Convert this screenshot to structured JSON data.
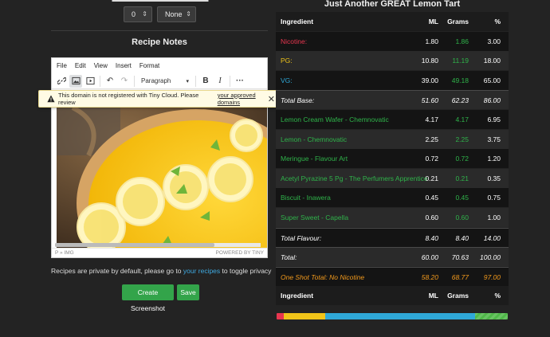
{
  "left": {
    "selects": [
      {
        "value": "0"
      },
      {
        "value": "None"
      }
    ],
    "notes_title": "Recipe Notes",
    "editor": {
      "menu": [
        "File",
        "Edit",
        "View",
        "Insert",
        "Format"
      ],
      "format_select": "Paragraph",
      "status_path": "P » IMG",
      "powered_by": "POWERED BY TINY"
    },
    "notice": {
      "text": "This domain is not registered with Tiny Cloud. Please review ",
      "link": "your approved domains",
      "end": "."
    },
    "privacy": {
      "before": "Recipes are private by default, please go to ",
      "link": "your recipes",
      "after": " to toggle privacy"
    },
    "buttons": {
      "screenshot": "Create Screenshot",
      "save": "Save"
    }
  },
  "table": {
    "title": "Just Another GREAT Lemon Tart",
    "headers": {
      "ingredient": "Ingredient",
      "ml": "ML",
      "grams": "Grams",
      "pct": "%"
    },
    "rows": [
      {
        "name": "Nicotine:",
        "ml": "1.80",
        "g": "1.86",
        "pct": "3.00",
        "color": "#e8364f",
        "gcolor": "#2fb34a",
        "style": "normal"
      },
      {
        "name": "PG:",
        "ml": "10.80",
        "g": "11.19",
        "pct": "18.00",
        "color": "#f0c419",
        "gcolor": "#2fb34a",
        "style": "normal"
      },
      {
        "name": "VG:",
        "ml": "39.00",
        "g": "49.18",
        "pct": "65.00",
        "color": "#2fa8d8",
        "gcolor": "#2fb34a",
        "style": "normal"
      },
      {
        "name": "Total Base:",
        "ml": "51.60",
        "g": "62.23",
        "pct": "86.00",
        "color": "#ffffff",
        "gcolor": "#ffffff",
        "style": "italic"
      },
      {
        "name": "Lemon Cream Wafer - Chemnovatic",
        "ml": "4.17",
        "g": "4.17",
        "pct": "6.95",
        "color": "#2fb34a",
        "gcolor": "#2fb34a",
        "style": "normal"
      },
      {
        "name": "Lemon - Chemnovatic",
        "ml": "2.25",
        "g": "2.25",
        "pct": "3.75",
        "color": "#2fb34a",
        "gcolor": "#2fb34a",
        "style": "normal"
      },
      {
        "name": "Meringue - Flavour Art",
        "ml": "0.72",
        "g": "0.72",
        "pct": "1.20",
        "color": "#2fb34a",
        "gcolor": "#2fb34a",
        "style": "normal"
      },
      {
        "name": "Acetyl Pyrazine 5 Pg - The Perfumers Apprentice",
        "ml": "0.21",
        "g": "0.21",
        "pct": "0.35",
        "color": "#2fb34a",
        "gcolor": "#2fb34a",
        "style": "normal"
      },
      {
        "name": "Biscuit - Inawera",
        "ml": "0.45",
        "g": "0.45",
        "pct": "0.75",
        "color": "#2fb34a",
        "gcolor": "#2fb34a",
        "style": "normal"
      },
      {
        "name": "Super Sweet - Capella",
        "ml": "0.60",
        "g": "0.60",
        "pct": "1.00",
        "color": "#2fb34a",
        "gcolor": "#2fb34a",
        "style": "normal"
      },
      {
        "name": "Total Flavour:",
        "ml": "8.40",
        "g": "8.40",
        "pct": "14.00",
        "color": "#ffffff",
        "gcolor": "#ffffff",
        "style": "italic"
      },
      {
        "name": "Total:",
        "ml": "60.00",
        "g": "70.63",
        "pct": "100.00",
        "color": "#ffffff",
        "gcolor": "#ffffff",
        "style": "italic"
      },
      {
        "name": "One Shot Total: No Nicotine",
        "ml": "58.20",
        "g": "68.77",
        "pct": "97.00",
        "color": "#f39a1c",
        "gcolor": "#f39a1c",
        "style": "italic"
      }
    ],
    "bar": [
      {
        "pct": 3,
        "color": "#e8364f"
      },
      {
        "pct": 18,
        "color": "#f0c419"
      },
      {
        "pct": 65,
        "color": "#2fa8d8"
      },
      {
        "pct": 14,
        "color": "#4fb848"
      }
    ]
  }
}
